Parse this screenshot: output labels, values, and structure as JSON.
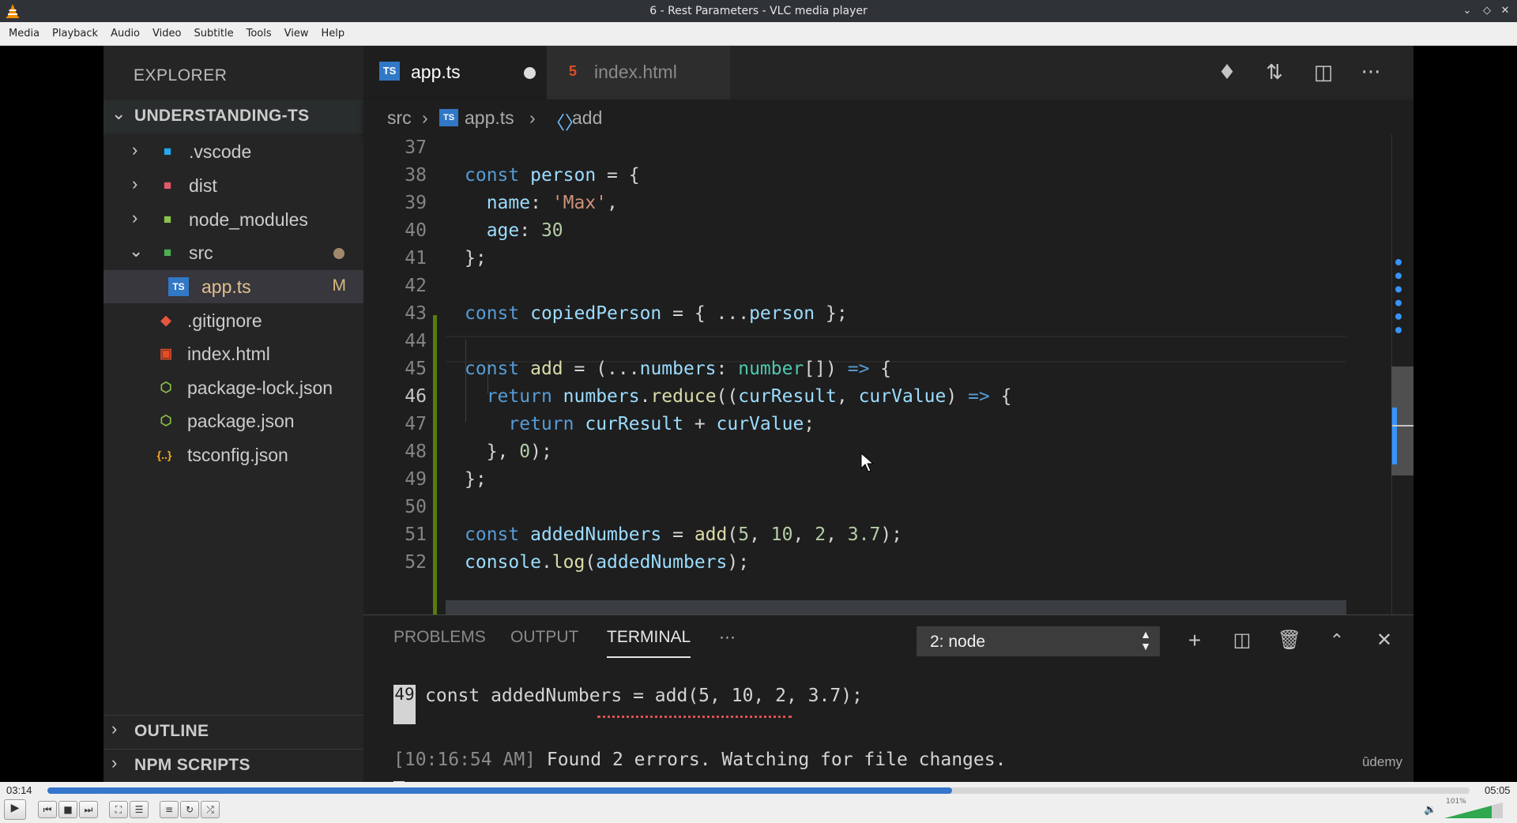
{
  "window": {
    "title": "6 - Rest Parameters - VLC media player"
  },
  "menu": [
    "Media",
    "Playback",
    "Audio",
    "Video",
    "Subtitle",
    "Tools",
    "View",
    "Help"
  ],
  "explorer": {
    "header": "EXPLORER",
    "project": "UNDERSTANDING-TS",
    "items": [
      {
        "label": ".vscode",
        "icon": "vscode-folder-icon"
      },
      {
        "label": "dist",
        "icon": "dist-folder-icon"
      },
      {
        "label": "node_modules",
        "icon": "node-folder-icon"
      },
      {
        "label": "src",
        "icon": "src-folder-icon"
      },
      {
        "label": "app.ts",
        "badge": "M",
        "icon": "typescript-file-icon"
      },
      {
        "label": ".gitignore",
        "icon": "git-file-icon"
      },
      {
        "label": "index.html",
        "icon": "html-file-icon"
      },
      {
        "label": "package-lock.json",
        "icon": "npm-file-icon"
      },
      {
        "label": "package.json",
        "icon": "npm-file-icon"
      },
      {
        "label": "tsconfig.json",
        "icon": "json-file-icon"
      }
    ],
    "outline": "OUTLINE",
    "npm_scripts": "NPM SCRIPTS"
  },
  "tabs": [
    {
      "label": "app.ts",
      "icon_text": "TS"
    },
    {
      "label": "index.html",
      "icon_text": "5"
    }
  ],
  "breadcrumb": [
    "src",
    "app.ts",
    "add"
  ],
  "code": {
    "line_numbers": [
      "37",
      "38",
      "39",
      "40",
      "41",
      "42",
      "43",
      "44",
      "45",
      "46",
      "47",
      "48",
      "49",
      "50",
      "51",
      "52"
    ],
    "lines": [
      "",
      "const person = {",
      "  name: 'Max',",
      "  age: 30",
      "};",
      "",
      "const copiedPerson = { ...person };",
      "",
      "const add = (...numbers: number[]) => {",
      "  return numbers.reduce((curResult, curValue) => {",
      "    return curResult + curValue;",
      "  }, 0);",
      "};",
      "",
      "const addedNumbers = add(5, 10, 2, 3.7);",
      "console.log(addedNumbers);"
    ]
  },
  "panel": {
    "tabs": [
      "PROBLEMS",
      "OUTPUT",
      "TERMINAL",
      "···"
    ],
    "terminal_select": "2: node",
    "term_line_number": "49",
    "term_line1": "const addedNumbers = add(5, 10, 2, 3.7);",
    "term_timestamp": "[10:16:54 AM]",
    "term_message": " Found 2 errors. Watching for file changes."
  },
  "watermark": "ûdemy",
  "player": {
    "elapsed": "03:14",
    "total": "05:05",
    "progress": 0.636,
    "volume_label": "101%"
  },
  "colors": {
    "accent": "#3576cb",
    "ts_blue": "#3178c6",
    "html_orange": "#e44d26"
  }
}
